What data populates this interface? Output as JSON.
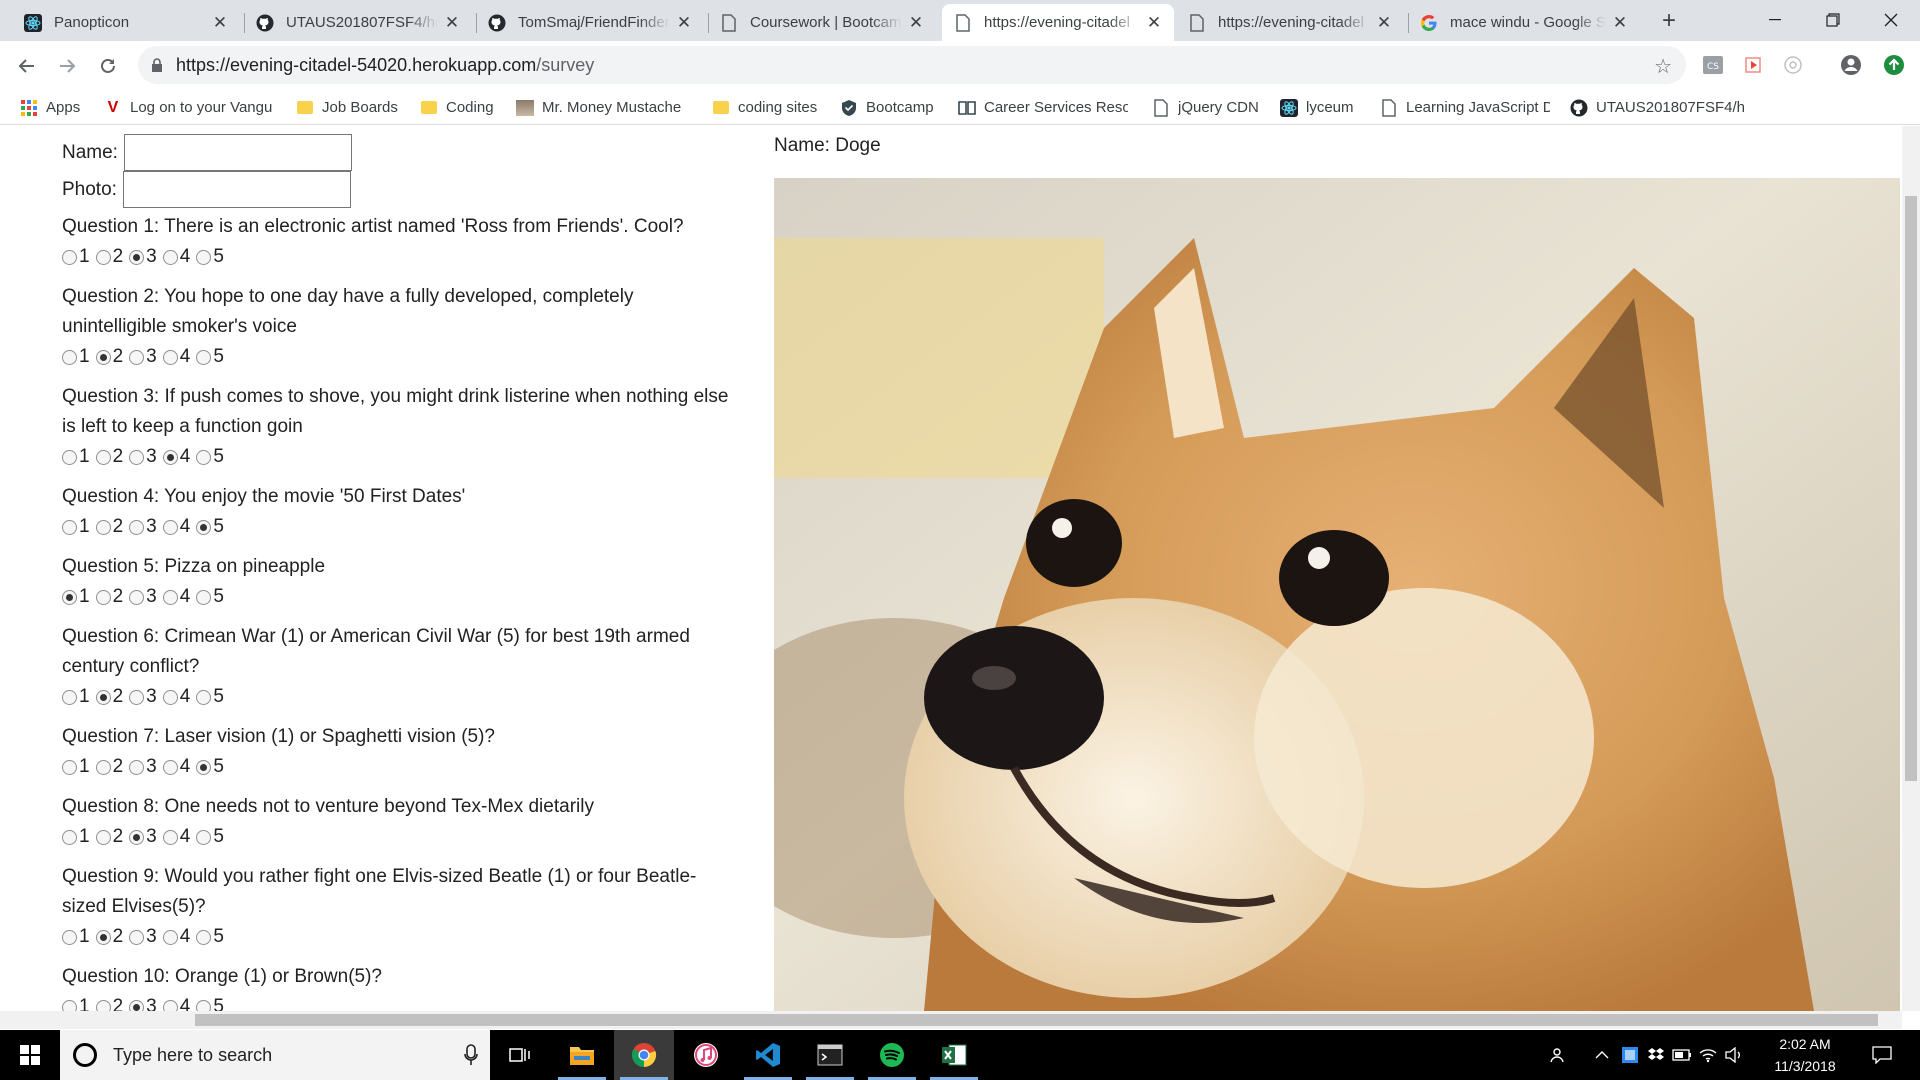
{
  "browser": {
    "tabs": [
      {
        "title": "Panopticon",
        "icon": "react-icon"
      },
      {
        "title": "UTAUS201807FSF4/ho",
        "icon": "github-icon"
      },
      {
        "title": "TomSmaj/FriendFinder",
        "icon": "github-icon"
      },
      {
        "title": "Coursework | Bootcamp",
        "icon": "page-icon"
      },
      {
        "title": "https://evening-citadel",
        "icon": "page-icon",
        "active": true
      },
      {
        "title": "https://evening-citadel",
        "icon": "page-icon"
      },
      {
        "title": "mace windu - Google S",
        "icon": "google-icon"
      }
    ],
    "url_host": "https://evening-citadel-54020.herokuapp.com",
    "url_path": "/survey",
    "bookmarks": [
      {
        "label": "Apps",
        "icon": "apps-grid-icon"
      },
      {
        "label": "Log on to your Vangu",
        "icon": "vanguard-icon"
      },
      {
        "label": "Job Boards",
        "icon": "folder-icon"
      },
      {
        "label": "Coding",
        "icon": "folder-icon"
      },
      {
        "label": "Mr. Money Mustache",
        "icon": "image-icon"
      },
      {
        "label": "coding sites",
        "icon": "folder-icon"
      },
      {
        "label": "Bootcamp",
        "icon": "shield-icon"
      },
      {
        "label": "Career Services Reso",
        "icon": "book-icon"
      },
      {
        "label": "jQuery CDN",
        "icon": "page-icon"
      },
      {
        "label": "lyceum",
        "icon": "react-icon"
      },
      {
        "label": "Learning JavaScript D",
        "icon": "page-icon"
      },
      {
        "label": "UTAUS201807FSF4/h",
        "icon": "github-icon"
      }
    ]
  },
  "survey": {
    "name_label": "Name:",
    "photo_label": "Photo:",
    "questions": [
      {
        "text": "Question 1: There is an electronic artist named 'Ross from Friends'. Cool?",
        "selected": 3
      },
      {
        "text": "Question 2: You hope to one day have a fully developed, completely unintelligible smoker's voice",
        "selected": 2
      },
      {
        "text": "Question 3: If push comes to shove, you might drink listerine when nothing else is left to keep a function goin",
        "selected": 4
      },
      {
        "text": "Question 4: You enjoy the movie '50 First Dates'",
        "selected": 5
      },
      {
        "text": "Question 5: Pizza on pineapple",
        "selected": 1
      },
      {
        "text": "Question 6: Crimean War (1) or American Civil War (5) for best 19th armed century conflict?",
        "selected": 2
      },
      {
        "text": "Question 7: Laser vision (1) or Spaghetti vision (5)?",
        "selected": 5
      },
      {
        "text": "Question 8: One needs not to venture beyond Tex-Mex dietarily",
        "selected": 3
      },
      {
        "text": "Question 9: Would you rather fight one Elvis-sized Beatle (1) or four Beatle-sized Elvises(5)?",
        "selected": 2
      },
      {
        "text": "Question 10: Orange (1) or Brown(5)?",
        "selected": 3
      }
    ],
    "options": [
      "1",
      "2",
      "3",
      "4",
      "5"
    ]
  },
  "result": {
    "name_text": "Name: Doge",
    "photo": "shiba-inu-doge-photo"
  },
  "taskbar": {
    "search_placeholder": "Type here to search",
    "time": "2:02 AM",
    "date": "11/3/2018"
  }
}
